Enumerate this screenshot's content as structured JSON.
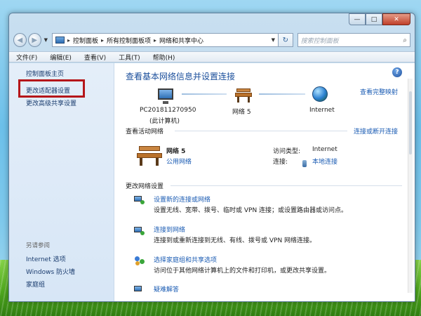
{
  "window": {
    "caption": {
      "minimize": "—",
      "maximize": "□",
      "close": "✕"
    }
  },
  "nav": {
    "back_glyph": "◀",
    "forward_glyph": "▶",
    "dropdown_glyph": "▼",
    "crumbs": [
      "控制面板",
      "所有控制面板项",
      "网络和共享中心"
    ],
    "crumb_sep": "▸",
    "refresh_glyph": "↻",
    "search_placeholder": "搜索控制面板",
    "search_glyph": "⌕"
  },
  "menu": [
    "文件(F)",
    "编辑(E)",
    "查看(V)",
    "工具(T)",
    "帮助(H)"
  ],
  "sidebar": {
    "items": [
      "控制面板主页",
      "更改适配器设置",
      "更改高级共享设置"
    ],
    "see_also_header": "另请参阅",
    "see_also": [
      "Internet 选项",
      "Windows 防火墙",
      "家庭组"
    ]
  },
  "main": {
    "help_glyph": "?",
    "title": "查看基本网络信息并设置连接",
    "view_full_map": "查看完整映射",
    "map": {
      "computer_name": "PC201811270950",
      "computer_sub": "(此计算机)",
      "network_name": "网络  5",
      "internet": "Internet"
    },
    "active": {
      "header": "查看活动网络",
      "connect_link": "连接或断开连接",
      "network_name": "网络  5",
      "network_type": "公用网络",
      "access_type_label": "访问类型:",
      "access_type_value": "Internet",
      "connection_label": "连接:",
      "connection_value": "本地连接"
    },
    "change": {
      "header": "更改网络设置",
      "tasks": [
        {
          "link": "设置新的连接或网络",
          "desc": "设置无线、宽带、拨号、临时或 VPN 连接；或设置路由器或访问点。"
        },
        {
          "link": "连接到网络",
          "desc": "连接到或重新连接到无线、有线、拨号或 VPN 网络连接。"
        },
        {
          "link": "选择家庭组和共享选项",
          "desc": "访问位于其他网络计算机上的文件和打印机，或更改共享设置。"
        },
        {
          "link": "疑难解答",
          "desc": ""
        }
      ]
    }
  },
  "colors": {
    "link": "#1a5bb3",
    "title": "#1a4e9b",
    "highlight_box": "#b5161a"
  }
}
